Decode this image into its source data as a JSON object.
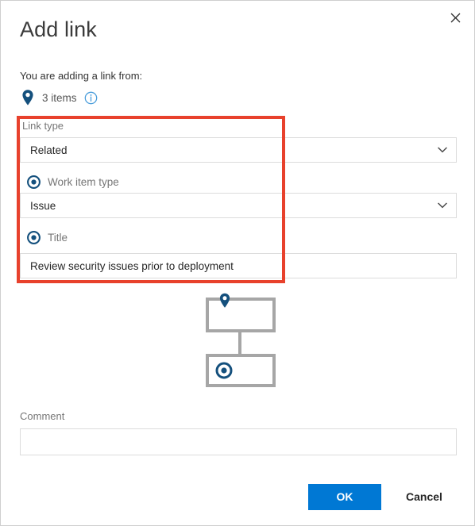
{
  "dialog": {
    "title": "Add link",
    "close_icon": "close-icon"
  },
  "source": {
    "intro_text": "You are adding a link from:",
    "count_label": "3 items",
    "pin_icon": "map-pin-icon",
    "info_icon": "info-circle-icon"
  },
  "fields": {
    "link_type": {
      "label": "Link type",
      "value": "Related",
      "chevron_icon": "chevron-down-icon"
    },
    "work_item_type": {
      "label": "Work item type",
      "radio_icon": "radio-selected-icon",
      "value": "Issue",
      "chevron_icon": "chevron-down-icon"
    },
    "title": {
      "label": "Title",
      "radio_icon": "radio-selected-icon",
      "value": "Review security issues prior to deployment",
      "placeholder": ""
    },
    "comment": {
      "label": "Comment",
      "value": "",
      "placeholder": ""
    }
  },
  "diagram": {
    "parent_icon": "map-pin-icon",
    "child_icon": "radio-selected-icon"
  },
  "footer": {
    "ok_label": "OK",
    "cancel_label": "Cancel"
  },
  "colors": {
    "accent_blue": "#0078d4",
    "icon_navy": "#14507d",
    "highlight_red": "#e8412c",
    "info_blue": "#4a9ddb",
    "diagram_gray": "#a6a6a6",
    "border_gray": "#dcdcdc"
  }
}
